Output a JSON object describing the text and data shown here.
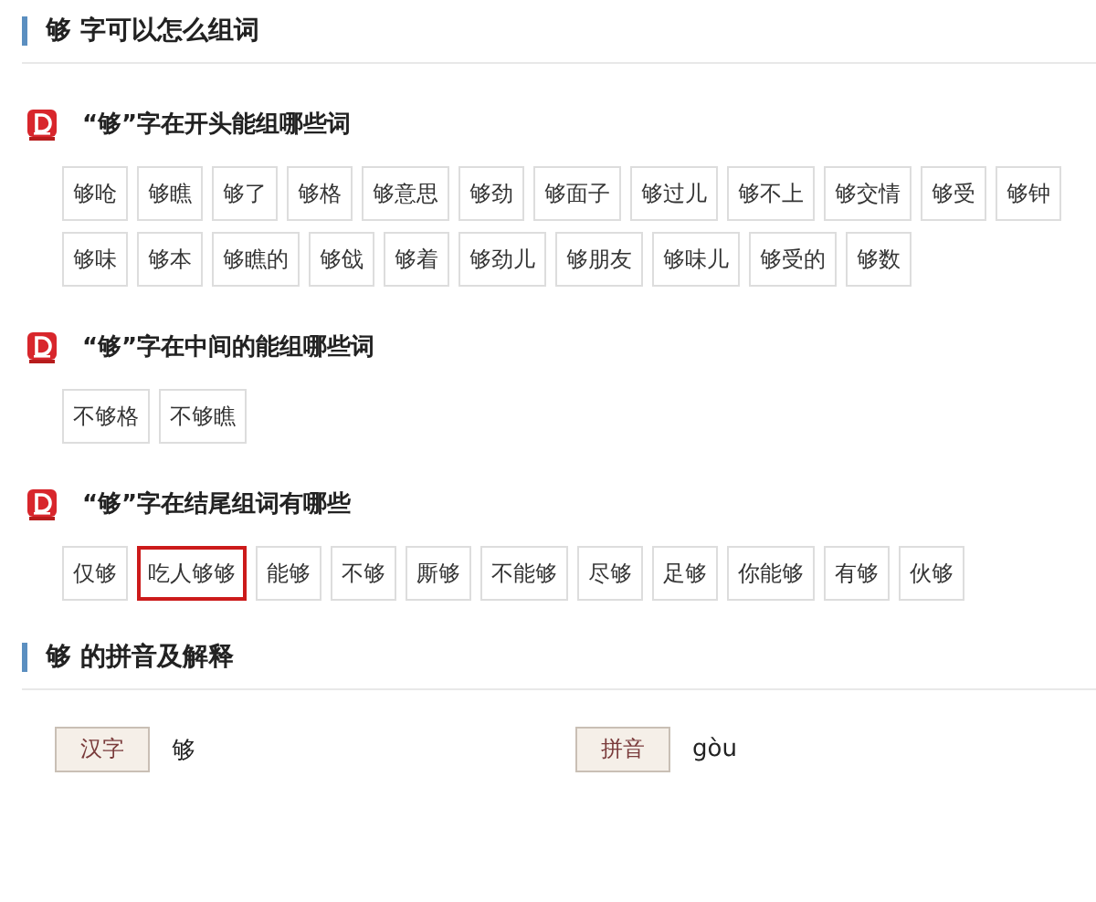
{
  "header": {
    "title": "够 字可以怎么组词"
  },
  "sections": [
    {
      "title": "“够”字在开头能组哪些词",
      "words": [
        {
          "text": "够呛",
          "highlighted": false
        },
        {
          "text": "够瞧",
          "highlighted": false
        },
        {
          "text": "够了",
          "highlighted": false
        },
        {
          "text": "够格",
          "highlighted": false
        },
        {
          "text": "够意思",
          "highlighted": false
        },
        {
          "text": "够劲",
          "highlighted": false
        },
        {
          "text": "够面子",
          "highlighted": false
        },
        {
          "text": "够过儿",
          "highlighted": false
        },
        {
          "text": "够不上",
          "highlighted": false
        },
        {
          "text": "够交情",
          "highlighted": false
        },
        {
          "text": "够受",
          "highlighted": false
        },
        {
          "text": "够钟",
          "highlighted": false
        },
        {
          "text": "够味",
          "highlighted": false
        },
        {
          "text": "够本",
          "highlighted": false
        },
        {
          "text": "够瞧的",
          "highlighted": false
        },
        {
          "text": "够戗",
          "highlighted": false
        },
        {
          "text": "够着",
          "highlighted": false
        },
        {
          "text": "够劲儿",
          "highlighted": false
        },
        {
          "text": "够朋友",
          "highlighted": false
        },
        {
          "text": "够味儿",
          "highlighted": false
        },
        {
          "text": "够受的",
          "highlighted": false
        },
        {
          "text": "够数",
          "highlighted": false
        }
      ]
    },
    {
      "title": "“够”字在中间的能组哪些词",
      "words": [
        {
          "text": "不够格",
          "highlighted": false
        },
        {
          "text": "不够瞧",
          "highlighted": false
        }
      ]
    },
    {
      "title": "“够”字在结尾组词有哪些",
      "words": [
        {
          "text": "仅够",
          "highlighted": false
        },
        {
          "text": "吃人够够",
          "highlighted": true
        },
        {
          "text": "能够",
          "highlighted": false
        },
        {
          "text": "不够",
          "highlighted": false
        },
        {
          "text": "厮够",
          "highlighted": false
        },
        {
          "text": "不能够",
          "highlighted": false
        },
        {
          "text": "尽够",
          "highlighted": false
        },
        {
          "text": "足够",
          "highlighted": false
        },
        {
          "text": "你能够",
          "highlighted": false
        },
        {
          "text": "有够",
          "highlighted": false
        },
        {
          "text": "伙够",
          "highlighted": false
        }
      ]
    }
  ],
  "pinyin_header": {
    "title": "够 的拼音及解释"
  },
  "info": [
    {
      "label": "汉字",
      "value": "够"
    },
    {
      "label": "拼音",
      "value": "gòu"
    }
  ]
}
